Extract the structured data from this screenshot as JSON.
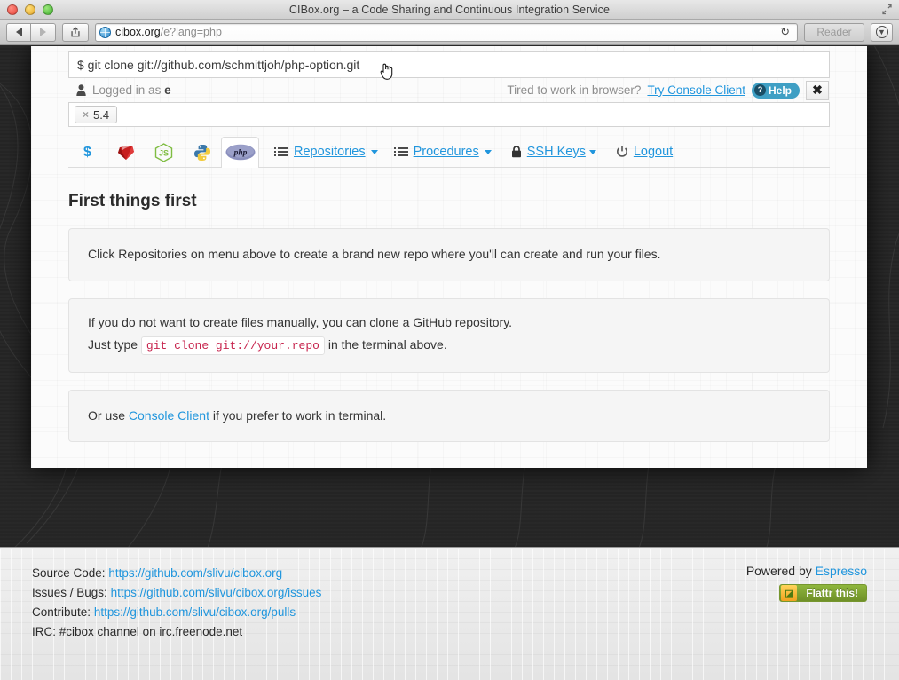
{
  "browser": {
    "window_title": "CIBox.org – a Code Sharing and Continuous Integration Service",
    "url_host": "cibox.org",
    "url_path": "/e?lang=php",
    "reader_label": "Reader",
    "back_icon": "triangle-left-icon",
    "forward_icon": "triangle-right-icon",
    "share_icon": "share-icon",
    "reload_icon": "↻",
    "downloads_icon": "⬇",
    "fullscreen_icon": "fullscreen-icon",
    "traffic_lights": [
      "close",
      "minimize",
      "zoom"
    ]
  },
  "terminal": {
    "prompt_symbol": "$",
    "command": "git clone git://github.com/schmittjoh/php-option.git",
    "full_line": "$ git clone git://github.com/schmittjoh/php-option.git",
    "cursor": "pointing-hand-cursor"
  },
  "status": {
    "user_icon": "user-icon",
    "logged_in_prefix": "Logged in as ",
    "logged_in_user": "e",
    "tired_text": "Tired to work in browser?",
    "console_client_link": "Try Console Client",
    "help_label": "Help",
    "help_badge": "?",
    "close_label": "✖"
  },
  "version": {
    "remove_symbol": "×",
    "label": "5.4"
  },
  "nav": {
    "lang_tabs": [
      {
        "name": "shell",
        "glyph": "$",
        "active": false
      },
      {
        "name": "ruby",
        "glyph": "ruby-gem-icon",
        "active": false
      },
      {
        "name": "nodejs",
        "glyph": "JS",
        "active": false
      },
      {
        "name": "python",
        "glyph": "python-icon",
        "active": false
      },
      {
        "name": "php",
        "glyph": "php",
        "active": true
      }
    ],
    "menu_items": [
      {
        "label": "Repositories",
        "icon": "list-icon",
        "caret": true
      },
      {
        "label": "Procedures",
        "icon": "list-icon",
        "caret": true
      },
      {
        "label": "SSH Keys",
        "icon": "lock-icon",
        "caret": true
      },
      {
        "label": "Logout",
        "icon": "power-icon",
        "caret": false
      }
    ]
  },
  "main": {
    "title": "First things first",
    "panel1": "Click Repositories on menu above to create a brand new repo where you'll can create and run your files.",
    "panel2_line1": "If you do not want to create files manually, you can clone a GitHub repository.",
    "panel2_prefix": "Just type ",
    "panel2_code": "git clone git://your.repo",
    "panel2_suffix": " in the terminal above.",
    "panel3_prefix": "Or use ",
    "panel3_link": "Console Client",
    "panel3_suffix": " if you prefer to work in terminal."
  },
  "footer": {
    "links": [
      {
        "label": "Source Code:",
        "url": "https://github.com/slivu/cibox.org"
      },
      {
        "label": "Issues / Bugs:",
        "url": "https://github.com/slivu/cibox.org/issues"
      },
      {
        "label": "Contribute:",
        "url": "https://github.com/slivu/cibox.org/pulls"
      }
    ],
    "irc_label": "IRC:",
    "irc_text": "#cibox channel on irc.freenode.net",
    "powered_by_prefix": "Powered by ",
    "powered_by_link": "Espresso",
    "flattr_label": "Flattr this!",
    "flattr_icon": "flattr-icon"
  },
  "colors": {
    "link_blue": "#2196dd",
    "help_teal": "#3f9fc4",
    "code_red": "#c7254e",
    "flattr_green": "#7ca52f",
    "page_dark": "#262626"
  }
}
